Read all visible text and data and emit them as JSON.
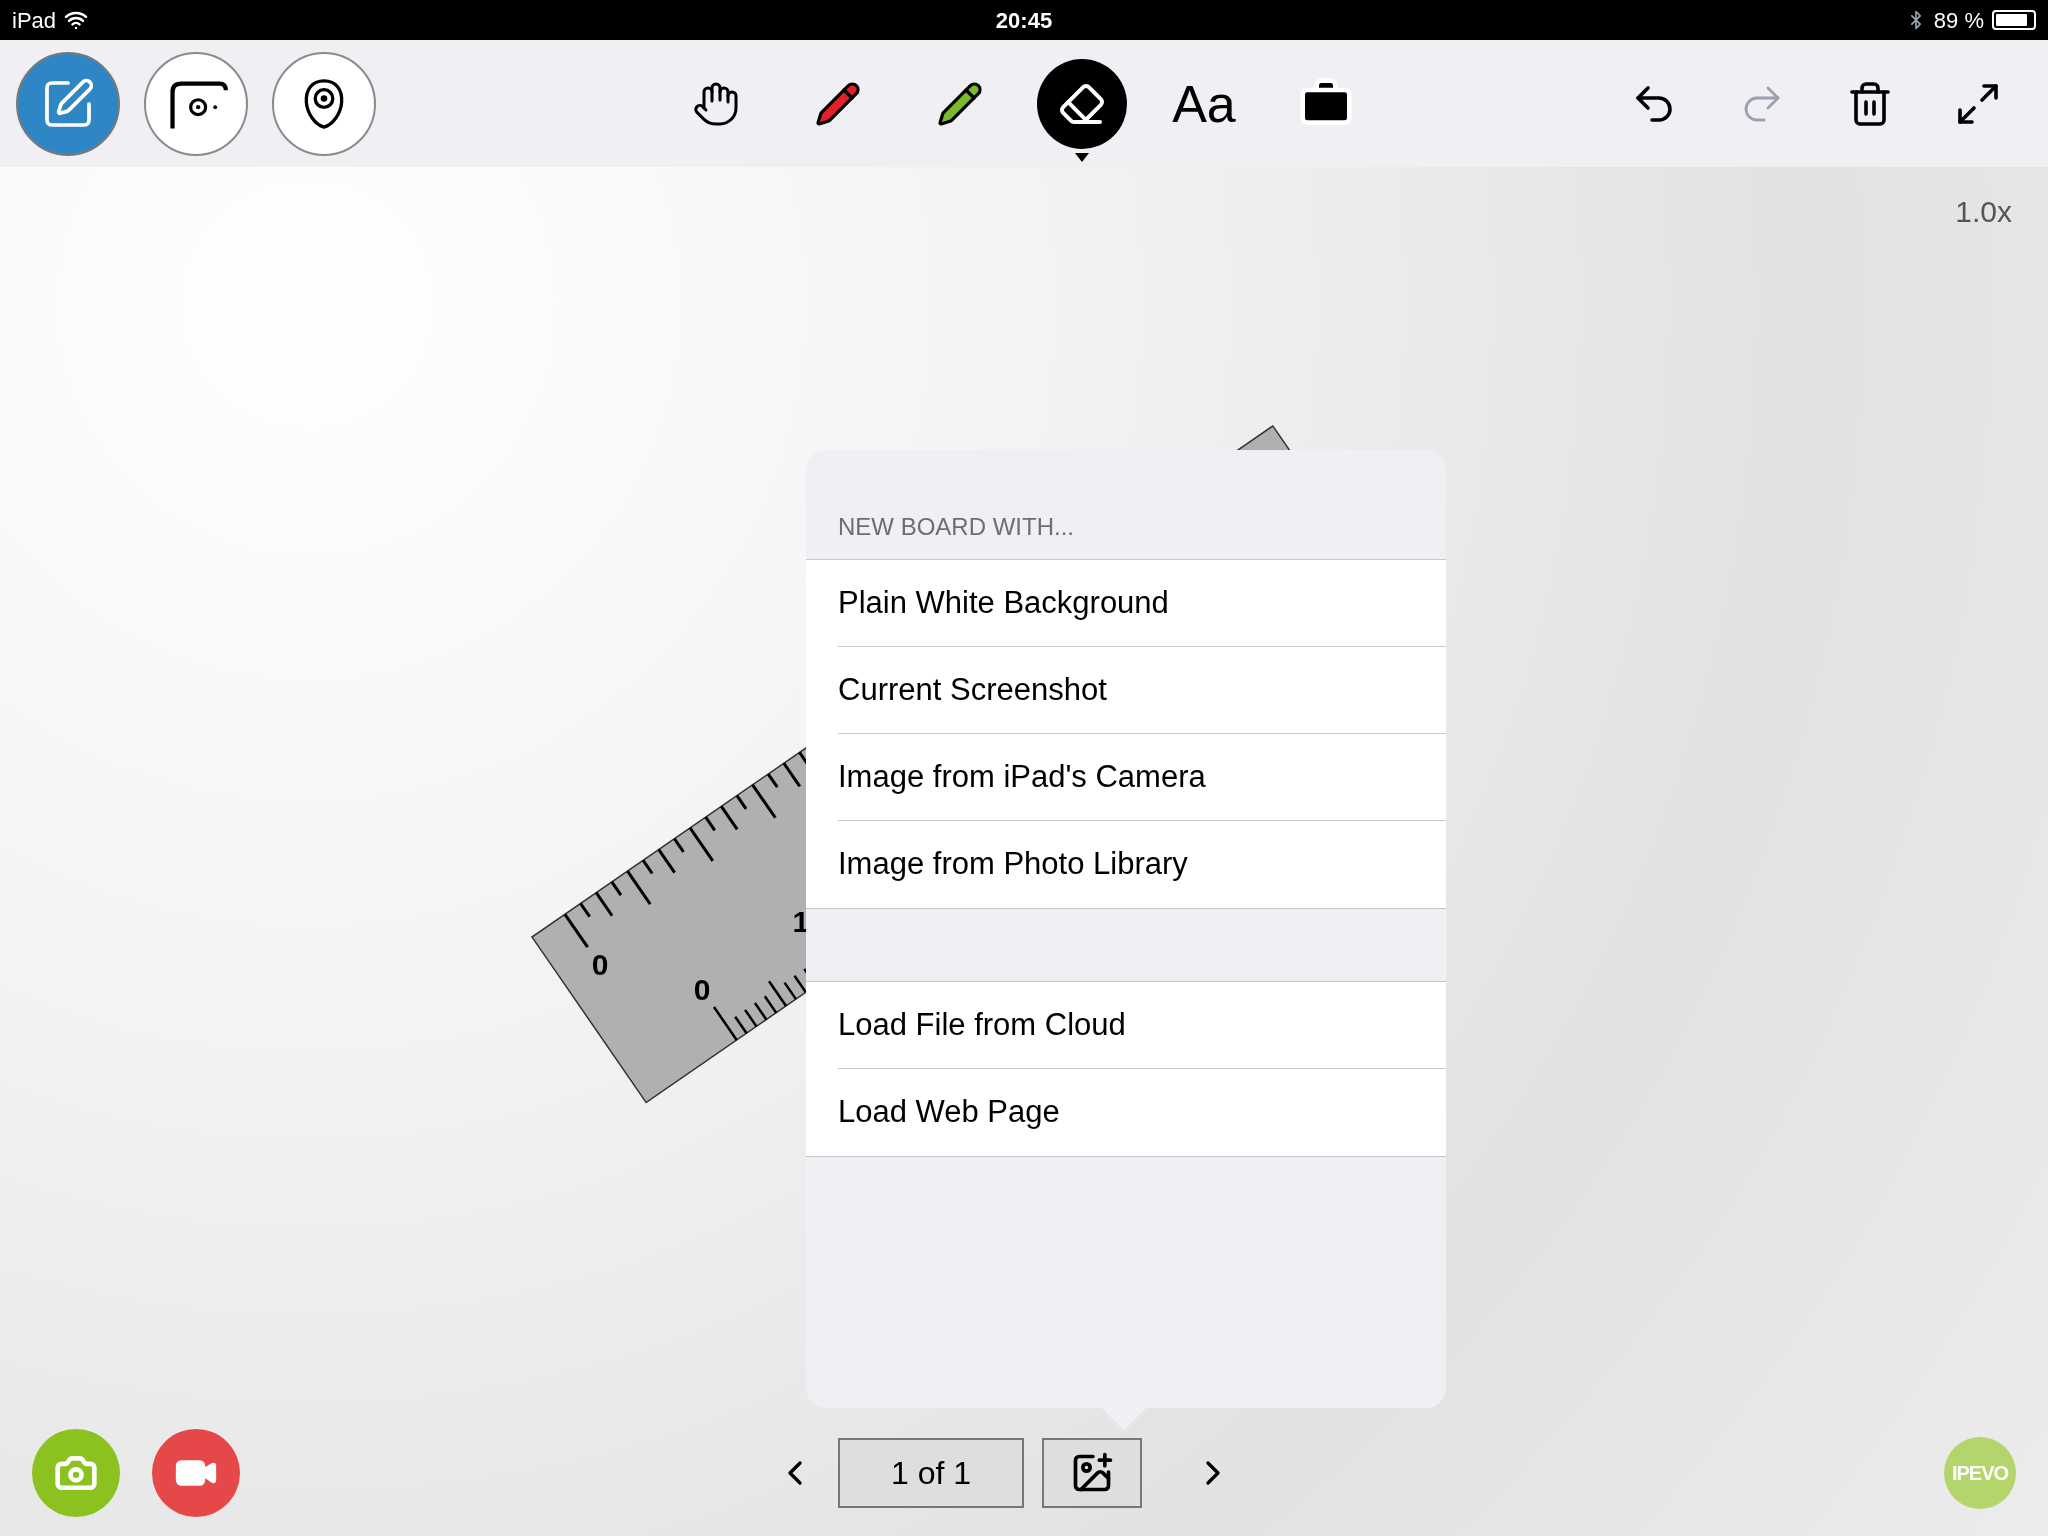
{
  "status_bar": {
    "device": "iPad",
    "time": "20:45",
    "battery": "89 %"
  },
  "modes": [
    {
      "kind": "whiteboard",
      "selected": true
    },
    {
      "kind": "camera",
      "selected": false
    },
    {
      "kind": "presenter",
      "selected": false
    }
  ],
  "tools": [
    {
      "kind": "hand",
      "selected": false
    },
    {
      "kind": "pen",
      "color": "#e0202a",
      "selected": false
    },
    {
      "kind": "pen",
      "color": "#7ab82e",
      "selected": false
    },
    {
      "kind": "eraser",
      "selected": true
    },
    {
      "kind": "text",
      "label": "Aa",
      "selected": false
    },
    {
      "kind": "toolbox",
      "selected": false
    }
  ],
  "actions": [
    {
      "kind": "undo",
      "disabled": false
    },
    {
      "kind": "redo",
      "disabled": true
    },
    {
      "kind": "trash",
      "disabled": false
    },
    {
      "kind": "expand",
      "disabled": false
    }
  ],
  "zoom_level": "1.0x",
  "ruler": {
    "top_labels": [
      "0"
    ],
    "bottom_labels": [
      "0",
      "1"
    ]
  },
  "popover": {
    "heading": "NEW BOARD WITH...",
    "sections": [
      [
        "Plain White Background",
        "Current Screenshot",
        "Image from iPad's Camera",
        "Image from Photo Library"
      ],
      [
        "Load File from Cloud",
        "Load Web Page"
      ]
    ]
  },
  "pager": {
    "page": "1 of 1"
  },
  "record": [
    {
      "kind": "photo",
      "color": "#8cc21f"
    },
    {
      "kind": "video",
      "color": "#e54848"
    }
  ],
  "brand": "IPEVO"
}
